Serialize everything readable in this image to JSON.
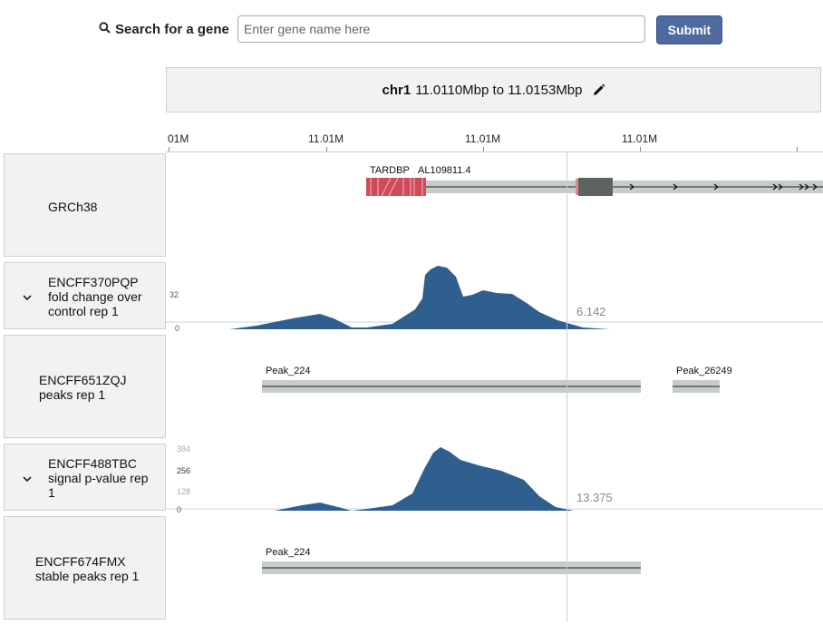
{
  "search": {
    "label": "Search for a gene",
    "placeholder": "Enter gene name here",
    "value": "",
    "submit_label": "Submit"
  },
  "location": {
    "chrom": "chr1",
    "range_text": "11.0110Mbp to 11.0153Mbp"
  },
  "axis": {
    "ticks": [
      "01M",
      "11.01M",
      "11.01M",
      "11.01M"
    ]
  },
  "tracks": [
    {
      "id": "grch38",
      "label_lines": [
        "GRCh38"
      ],
      "collapsible": false,
      "genes": [
        "TARDBP",
        "AL109811.4"
      ]
    },
    {
      "id": "encff370pqp",
      "label_lines": [
        "ENCFF370PQP",
        "fold change over",
        "control rep 1"
      ],
      "collapsible": true,
      "scale_labels": [
        "32",
        "0"
      ],
      "hover_value": "6.142"
    },
    {
      "id": "encff651zqj",
      "label_lines": [
        "ENCFF651ZQJ",
        "peaks rep 1"
      ],
      "collapsible": false,
      "peaks": [
        "Peak_224",
        "Peak_26249"
      ]
    },
    {
      "id": "encff488tbc",
      "label_lines": [
        "ENCFF488TBC",
        "signal p-value rep",
        "1"
      ],
      "collapsible": true,
      "scale_labels": [
        "384",
        "256",
        "128",
        "0"
      ],
      "hover_value": "13.375"
    },
    {
      "id": "encff674fmx",
      "label_lines": [
        "ENCFF674FMX",
        "stable peaks rep 1"
      ],
      "collapsible": false,
      "peaks": [
        "Peak_224"
      ]
    }
  ],
  "colors": {
    "signal": "#2f5f8f",
    "gene_exon": "#cf4b5b",
    "gene_band": "#c6cdc8",
    "peak_band": "#c6cdc8",
    "button": "#4f6a9f"
  }
}
